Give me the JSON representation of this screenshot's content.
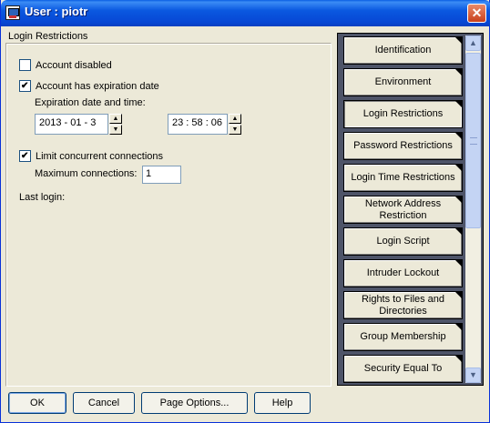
{
  "window": {
    "title": "User : piotr",
    "close_symbol": "✕"
  },
  "section_label": "Login Restrictions",
  "account_disabled": {
    "label": "Account disabled",
    "checked": false
  },
  "account_expiration": {
    "label": "Account has expiration date",
    "checked": true,
    "datetime_label": "Expiration date and time:",
    "date": "2013  -  01  -   3",
    "time": "23 : 58 : 06"
  },
  "limit_connections": {
    "label": "Limit concurrent connections",
    "checked": true,
    "max_label": "Maximum connections:",
    "max_value": "1"
  },
  "last_login_label": "Last login:",
  "nav_tabs": [
    {
      "label": "Identification"
    },
    {
      "label": "Environment"
    },
    {
      "label": "Login Restrictions",
      "active": true
    },
    {
      "label": "Password Restrictions"
    },
    {
      "label": "Login Time Restrictions"
    },
    {
      "label": "Network Address Restriction"
    },
    {
      "label": "Login Script"
    },
    {
      "label": "Intruder Lockout"
    },
    {
      "label": "Rights to Files and Directories"
    },
    {
      "label": "Group Membership"
    },
    {
      "label": "Security Equal To"
    }
  ],
  "buttons": {
    "ok": "OK",
    "cancel": "Cancel",
    "page_options": "Page Options...",
    "help": "Help"
  },
  "colors": {
    "title_bar": "#0a58e0",
    "panel_bg": "#4e5468",
    "window_bg": "#ece9d8"
  }
}
